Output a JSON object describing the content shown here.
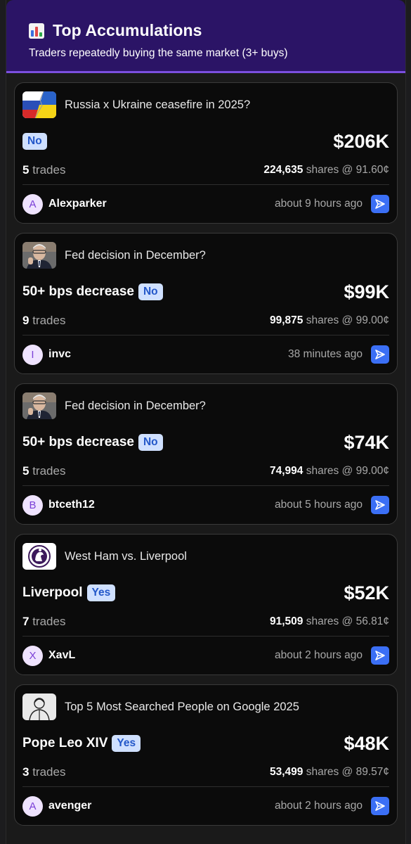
{
  "header": {
    "title": "Top Accumulations",
    "subtitle": "Traders repeatedly buying the same market (3+ buys)",
    "icon": "bar-chart-icon"
  },
  "colors": {
    "header_bg": "#2b1466",
    "header_border": "#7b4fe0",
    "card_bg": "#0b0b0b",
    "badge_bg": "#cfe0ff",
    "badge_text": "#2358c9",
    "avatar_bg": "#efe3ff",
    "avatar_text": "#7a3fd6",
    "share_button": "#3b6ff5"
  },
  "cards": [
    {
      "thumb": "ukraine-russia-flag-image",
      "market": "Russia x Ukraine ceasefire in 2025?",
      "outcome": "",
      "side": "No",
      "amount": "$206K",
      "trade_count": "5",
      "trades_word": "trades",
      "shares": "224,635",
      "price_text": "shares @ 91.60¢",
      "avatar_letter": "A",
      "user": "Alexparker",
      "time": "about 9 hours ago"
    },
    {
      "thumb": "fed-chair-portrait-image",
      "market": "Fed decision in December?",
      "outcome": "50+ bps decrease",
      "side": "No",
      "amount": "$99K",
      "trade_count": "9",
      "trades_word": "trades",
      "shares": "99,875",
      "price_text": "shares @ 99.00¢",
      "avatar_letter": "I",
      "user": "invc",
      "time": "38 minutes ago"
    },
    {
      "thumb": "fed-chair-portrait-image",
      "market": "Fed decision in December?",
      "outcome": "50+ bps decrease",
      "side": "No",
      "amount": "$74K",
      "trade_count": "5",
      "trades_word": "trades",
      "shares": "74,994",
      "price_text": "shares @ 99.00¢",
      "avatar_letter": "B",
      "user": "btceth12",
      "time": "about 5 hours ago"
    },
    {
      "thumb": "premier-league-logo-image",
      "market": "West Ham vs. Liverpool",
      "outcome": "Liverpool",
      "side": "Yes",
      "amount": "$52K",
      "trade_count": "7",
      "trades_word": "trades",
      "shares": "91,509",
      "price_text": "shares @ 56.81¢",
      "avatar_letter": "X",
      "user": "XavL",
      "time": "about 2 hours ago"
    },
    {
      "thumb": "person-silhouette-image",
      "market": "Top 5 Most Searched People on Google 2025",
      "outcome": "Pope Leo XIV",
      "side": "Yes",
      "amount": "$48K",
      "trade_count": "3",
      "trades_word": "trades",
      "shares": "53,499",
      "price_text": "shares @ 89.57¢",
      "avatar_letter": "A",
      "user": "avenger",
      "time": "about 2 hours ago"
    }
  ]
}
